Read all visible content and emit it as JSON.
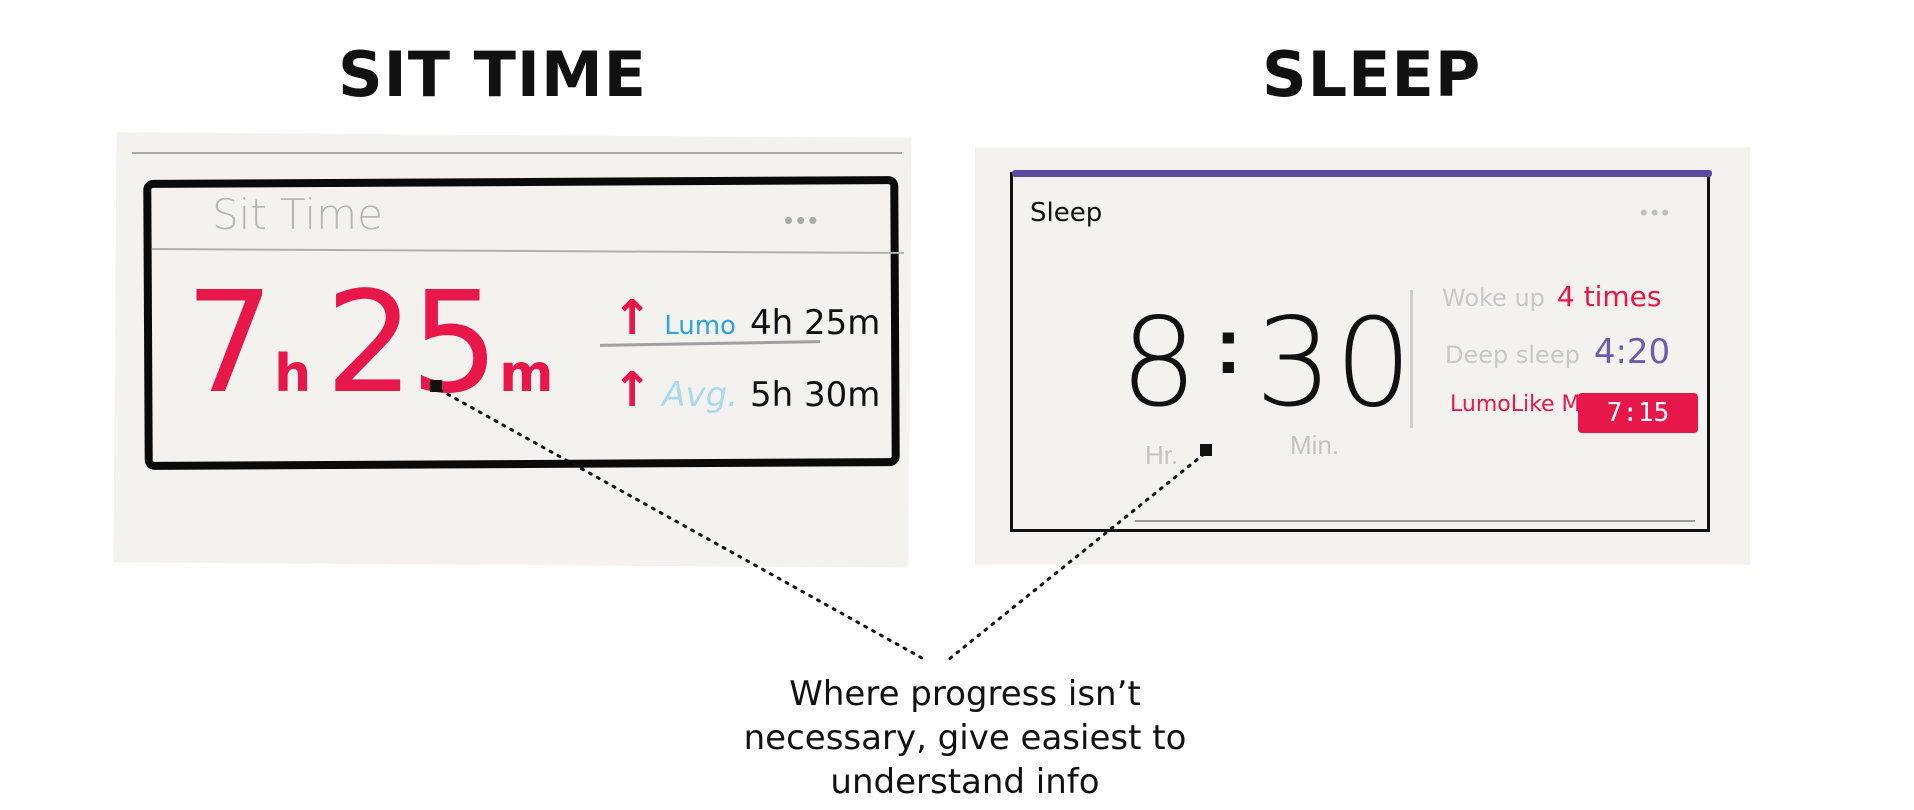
{
  "headings": {
    "sit": "SIT TIME",
    "sleep": "SLEEP"
  },
  "sit_card": {
    "title": "Sit Time",
    "menu": "•••",
    "total_hours": "7",
    "hours_unit": "h",
    "total_minutes": "25",
    "minutes_unit": "m",
    "comparisons": [
      {
        "arrow": "↑",
        "label": "Lumo",
        "value": "4h 25m"
      },
      {
        "arrow": "↑",
        "label": "Avg.",
        "value": "5h 30m"
      }
    ]
  },
  "sleep_card": {
    "title": "Sleep",
    "menu": "•••",
    "hours": "8",
    "colon": ":",
    "minutes": "30",
    "hours_label": "Hr.",
    "minutes_label": "Min.",
    "stats": {
      "woke_label": "Woke up",
      "woke_value": "4 times",
      "deep_label": "Deep sleep",
      "deep_value": "4:20",
      "lumo_label": "LumoLike Me",
      "lumo_value": "7:15"
    }
  },
  "annotation": {
    "caption_lines": [
      "Where progress isn’t",
      "necessary, give easiest to",
      "understand info"
    ]
  },
  "colors": {
    "accent_red": "#e8174a",
    "lumo_blue": "#2ea3de",
    "sleep_purple": "#5b4ba0",
    "deep_sleep_purple": "#6a5dab"
  }
}
